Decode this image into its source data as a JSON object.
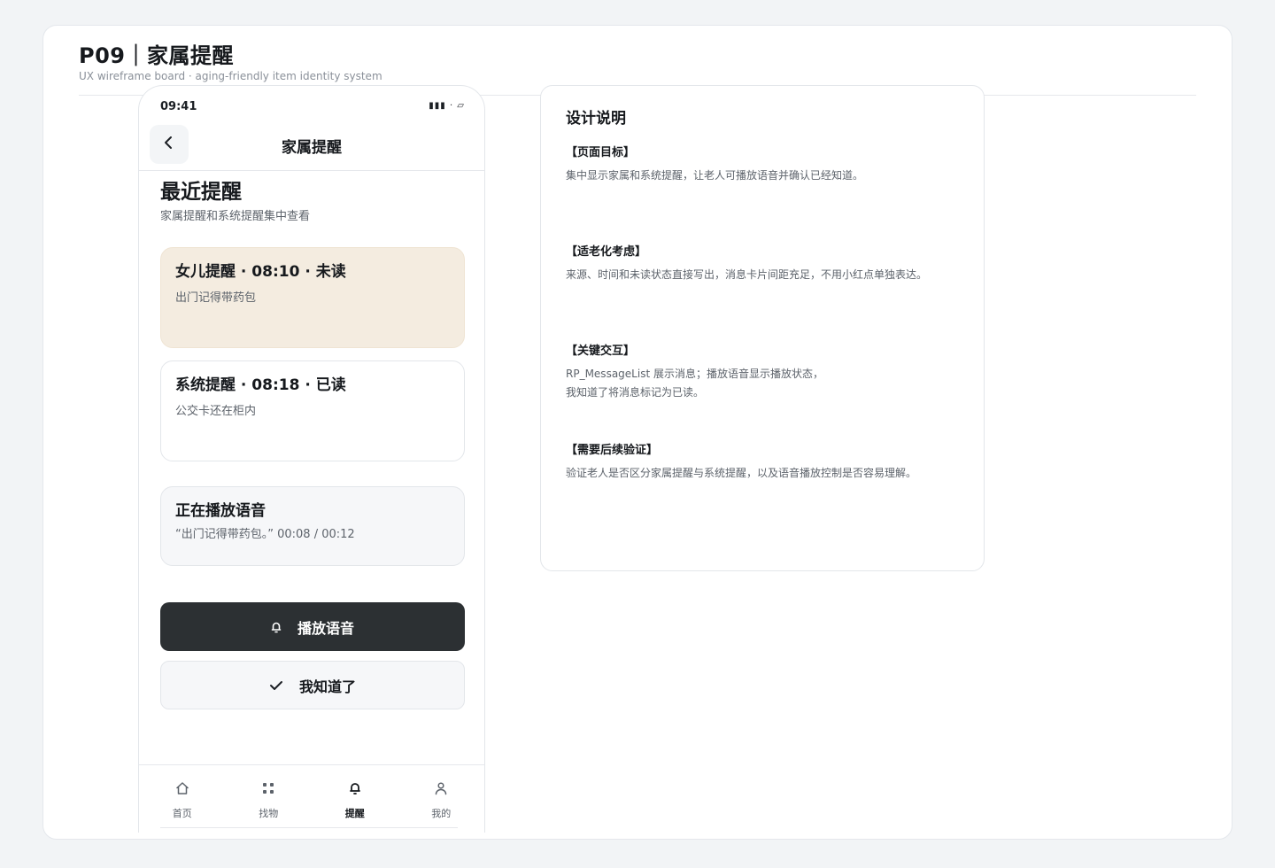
{
  "board": {
    "title": "P09｜家属提醒",
    "subtitle": "UX wireframe board · aging-friendly item identity system"
  },
  "phone": {
    "status_time": "09:41",
    "status_icons": "▮▮▮ · ▱",
    "nav_title": "家属提醒",
    "heading": "最近提醒",
    "subheading": "家属提醒和系统提醒集中查看",
    "messages": [
      {
        "head": "女儿提醒 · 08:10 · 未读",
        "body": "出门记得带药包"
      },
      {
        "head": "系统提醒 · 08:18 · 已读",
        "body": "公交卡还在柜内"
      }
    ],
    "playing": {
      "title": "正在播放语音",
      "text": "“出门记得带药包。” 00:08 / 00:12"
    },
    "play_button": "播放语音",
    "ack_button": "我知道了",
    "tabs": [
      {
        "label": "首页",
        "icon": "home-icon"
      },
      {
        "label": "找物",
        "icon": "grid-icon"
      },
      {
        "label": "提醒",
        "icon": "bell-icon",
        "active": true
      },
      {
        "label": "我的",
        "icon": "user-icon"
      }
    ]
  },
  "notes": {
    "title": "设计说明",
    "sections": [
      {
        "head": "【页面目标】",
        "text": "集中显示家属和系统提醒，让老人可播放语音并确认已经知道。"
      },
      {
        "head": "【适老化考虑】",
        "text": "来源、时间和未读状态直接写出，消息卡片间距充足，不用小红点单独表达。"
      },
      {
        "head": "【关键交互】",
        "text": "RP_MessageList 展示消息；播放语音显示播放状态，\n我知道了将消息标记为已读。"
      },
      {
        "head": "【需要后续验证】",
        "text": "验证老人是否区分家属提醒与系统提醒，以及语音播放控制是否容易理解。"
      }
    ]
  }
}
